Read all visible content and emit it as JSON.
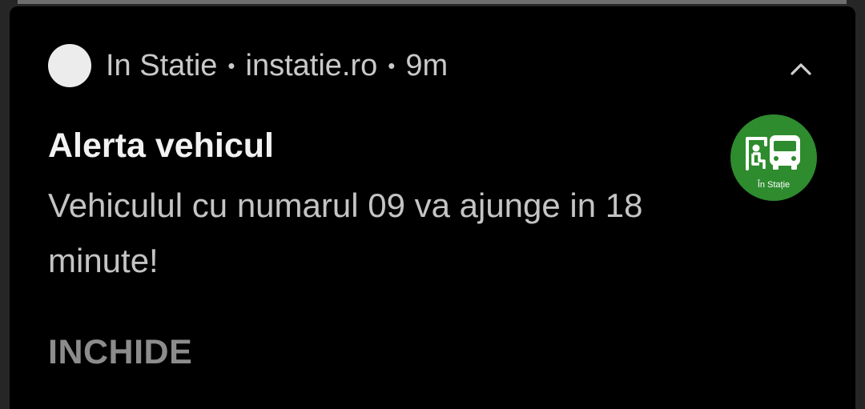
{
  "notification": {
    "app_name": "In Statie",
    "separator": "•",
    "source": "instatie.ro",
    "time": "9m",
    "title": "Alerta vehicul",
    "body": "Vehiculul cu numarul 09 va ajunge in 18 minute!",
    "large_icon_label": "În Stație",
    "large_icon_color": "#2e8b2e",
    "expand_icon": "chevron-up-icon",
    "actions": [
      {
        "label": "INCHIDE"
      }
    ]
  }
}
